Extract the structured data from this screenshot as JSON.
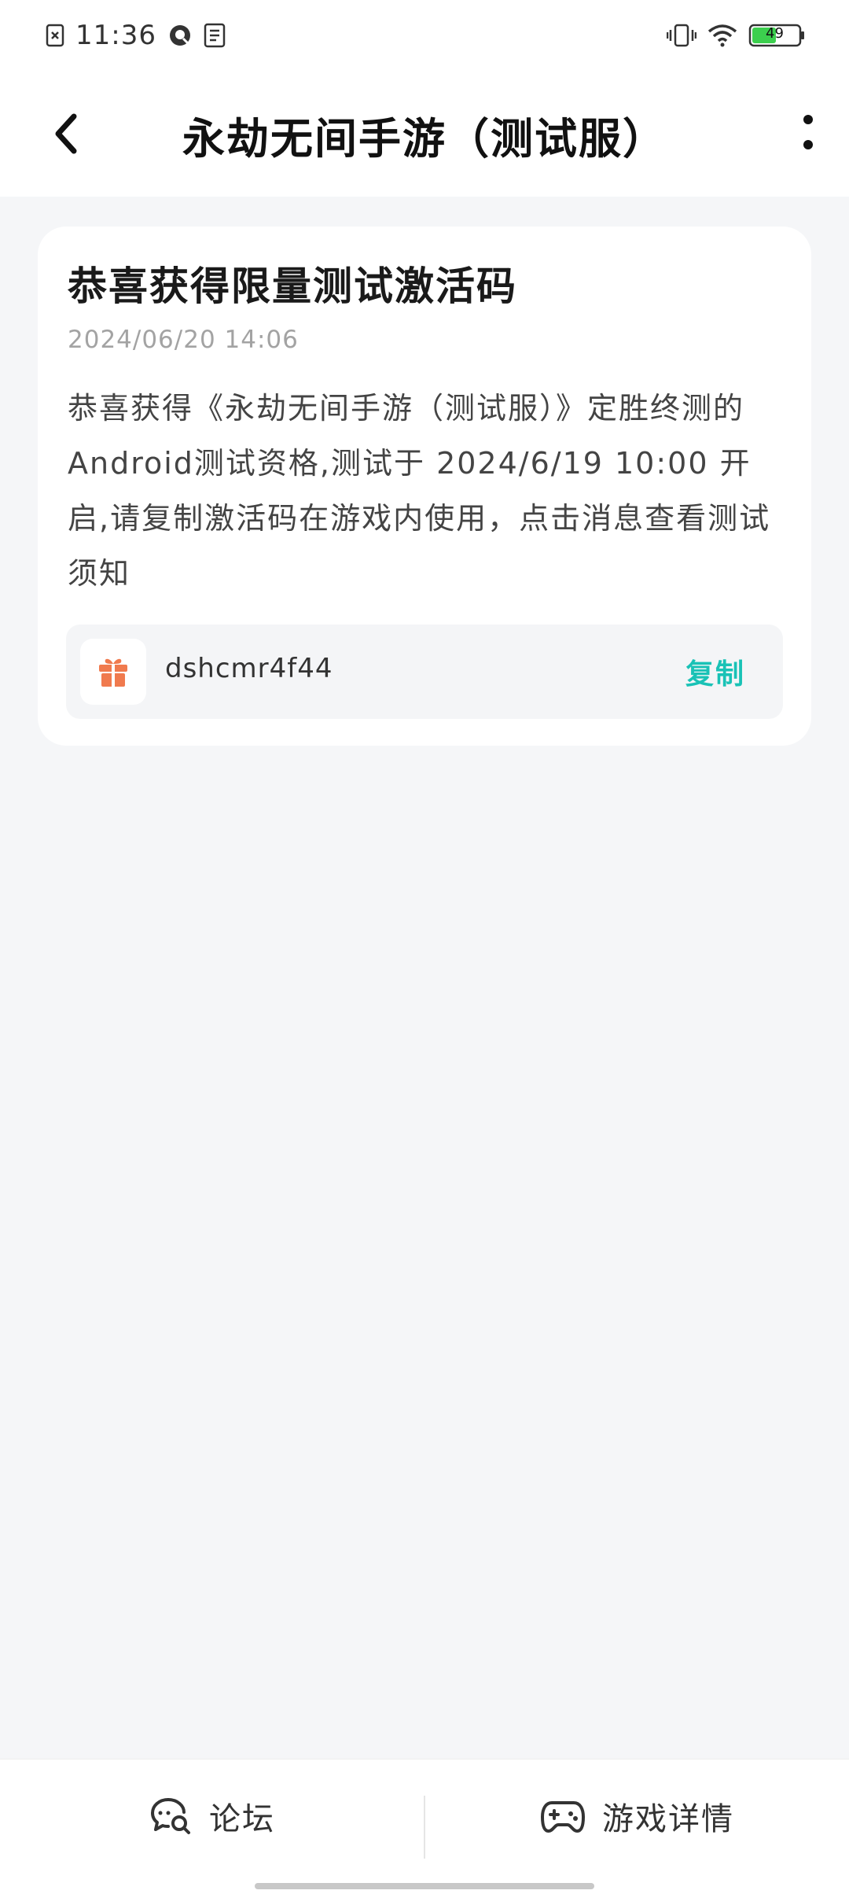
{
  "status_bar": {
    "time": "11:36",
    "battery": "49",
    "icons": [
      "notification-x-icon",
      "qq-icon",
      "document-icon",
      "vibrate-icon",
      "wifi-icon",
      "battery-icon"
    ]
  },
  "header": {
    "title": "永劫无间手游（测试服）",
    "back_icon": "chevron-left-icon",
    "more_icon": "more-vertical-icon"
  },
  "message": {
    "title": "恭喜获得限量测试激活码",
    "timestamp": "2024/06/20 14:06",
    "body": "恭喜获得《永劫无间手游（测试服）》定胜终测的Android测试资格,测试于 2024/6/19 10:00 开启,请复制激活码在游戏内使用，点击消息查看测试须知",
    "code": "dshcmr4f44",
    "copy_label": "复制",
    "gift_icon": "gift-icon"
  },
  "bottom_nav": {
    "forum_label": "论坛",
    "forum_icon": "chat-search-icon",
    "detail_label": "游戏详情",
    "detail_icon": "gamepad-icon"
  },
  "colors": {
    "accent": "#19c2b6",
    "gift": "#f07a4e",
    "battery": "#3ccf4e",
    "background": "#f5f6f8"
  }
}
